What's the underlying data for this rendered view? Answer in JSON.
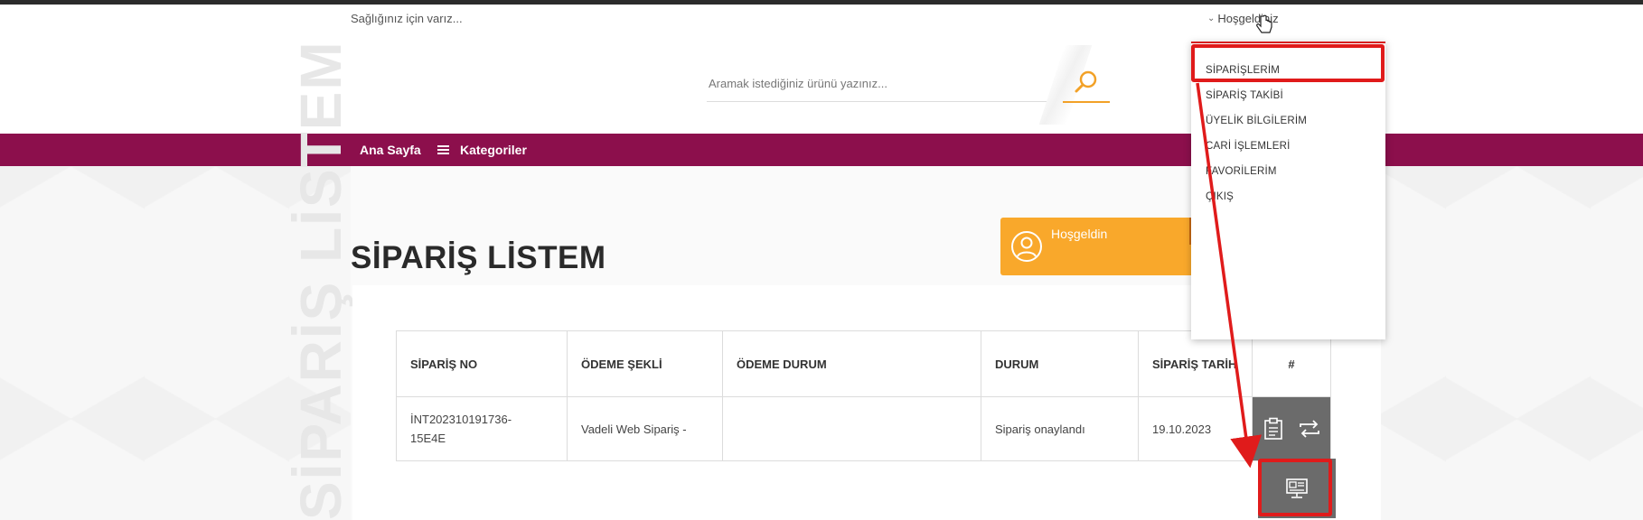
{
  "topbar": {
    "slogan": "Sağlığınız için varız...",
    "welcome_label": "Hoşgeldiniz"
  },
  "search": {
    "placeholder": "Aramak istediğiniz ürünü yazınız..."
  },
  "nav": {
    "home": "Ana Sayfa",
    "categories": "Kategoriler"
  },
  "page": {
    "title": "SİPARİŞ LİSTEM",
    "vertical_title": "SİPARİŞ LİSTEM"
  },
  "welcome_card": {
    "title": "Hoşgeldin"
  },
  "dropdown": {
    "items": [
      {
        "label": "SİPARİŞLERİM"
      },
      {
        "label": "SİPARİŞ TAKİBİ"
      },
      {
        "label": "ÜYELİK BİLGİLERİM"
      },
      {
        "label": "CARİ İŞLEMLERİ"
      },
      {
        "label": "FAVORİLERİM"
      },
      {
        "label": "ÇIKIŞ"
      }
    ]
  },
  "orders_table": {
    "headers": [
      "SİPARİŞ NO",
      "ÖDEME ŞEKLİ",
      "ÖDEME DURUM",
      "DURUM",
      "SİPARİŞ TARİH",
      "#"
    ],
    "rows": [
      {
        "order_no": "İNT202310191736-15E4E",
        "payment_method": "Vadeli Web Sipariş -",
        "payment_status": "",
        "status": "Sipariş onaylandı",
        "date": "19.10.2023"
      }
    ]
  },
  "icons": {
    "search": "search-icon",
    "user": "user-circle-icon",
    "clipboard": "clipboard-icon",
    "repeat": "repeat-icon",
    "invoice": "invoice-screen-icon"
  },
  "colors": {
    "brand": "#8c0f4c",
    "accent": "#f9a82b",
    "status_ok": "#4fbf3a",
    "annotation": "#e01b1b"
  }
}
